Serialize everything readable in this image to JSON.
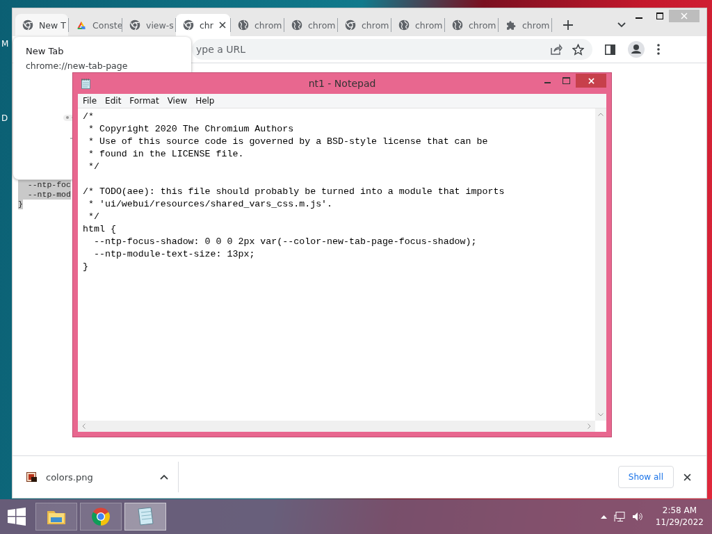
{
  "desktop": {
    "icon_labels": [
      "M",
      "D"
    ]
  },
  "browser": {
    "tabs": [
      {
        "title": "New T",
        "kind": "chrome",
        "selected": false,
        "hovered": true
      },
      {
        "title": "Conste",
        "kind": "drive",
        "selected": false,
        "hovered": false
      },
      {
        "title": "view-s",
        "kind": "chrome",
        "selected": false,
        "hovered": false
      },
      {
        "title": "chr",
        "kind": "chrome",
        "selected": true,
        "hovered": false
      },
      {
        "title": "chrom",
        "kind": "globe",
        "selected": false,
        "hovered": false
      },
      {
        "title": "chrom",
        "kind": "globe",
        "selected": false,
        "hovered": false
      },
      {
        "title": "chrom",
        "kind": "chrome",
        "selected": false,
        "hovered": false
      },
      {
        "title": "chrom",
        "kind": "globe",
        "selected": false,
        "hovered": false
      },
      {
        "title": "chrom",
        "kind": "globe",
        "selected": false,
        "hovered": false
      },
      {
        "title": "chrom",
        "kind": "puzzle",
        "selected": false,
        "hovered": false
      }
    ],
    "hover_card": {
      "title": "New Tab",
      "url": "chrome://new-tab-page"
    },
    "address_bar": {
      "placeholder": "ype a URL"
    },
    "page_lines": [
      "  --ntp-foc",
      "  --ntp-mod",
      "}"
    ],
    "downloads": {
      "items": [
        {
          "filename": "colors.png"
        }
      ],
      "show_all": "Show all"
    }
  },
  "notepad": {
    "title": "nt1 - Notepad",
    "menu": [
      "File",
      "Edit",
      "Format",
      "View",
      "Help"
    ],
    "blocks": [
      [
        "/*",
        " * Copyright 2020 The Chromium Authors",
        " * Use of this source code is governed by a BSD-style license that can be",
        " * found in the LICENSE file.",
        " */"
      ],
      [
        "/* TODO(aee): this file should probably be turned into a module that imports",
        " * 'ui/webui/resources/shared_vars_css.m.js'.",
        " */",
        "html {",
        "  --ntp-focus-shadow: 0 0 0 2px var(--color-new-tab-page-focus-shadow);",
        "  --ntp-module-text-size: 13px;",
        "}"
      ]
    ]
  },
  "taskbar": {
    "apps": [
      {
        "kind": "explorer",
        "selected": false
      },
      {
        "kind": "chrome",
        "selected": false
      },
      {
        "kind": "notepad",
        "selected": true
      }
    ],
    "time": "2:58 AM",
    "date": "11/29/2022"
  }
}
